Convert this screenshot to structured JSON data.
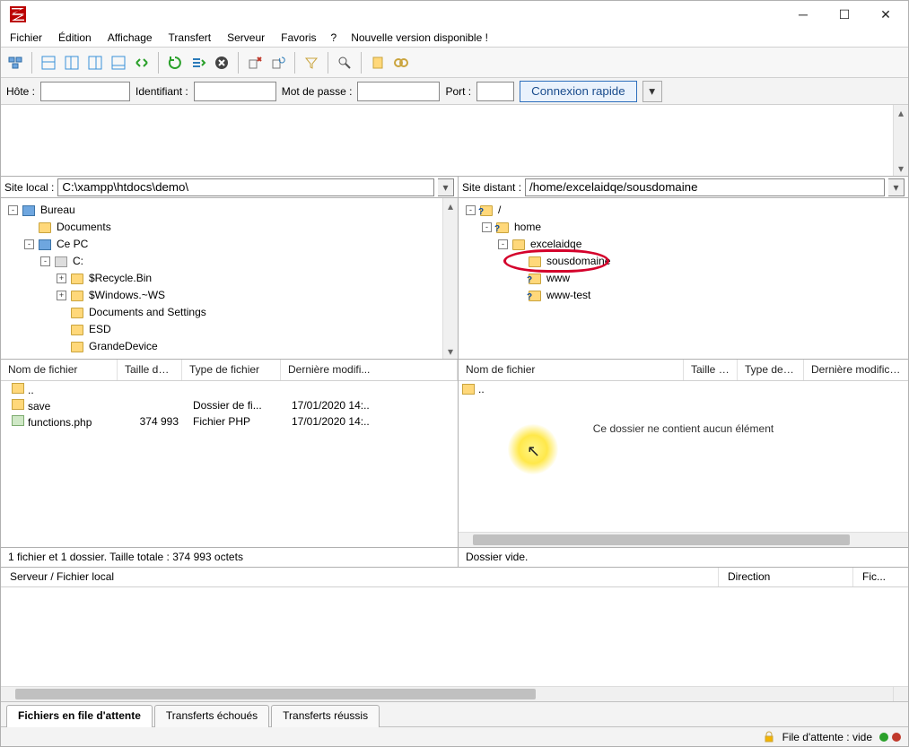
{
  "menubar": [
    "Fichier",
    "Édition",
    "Affichage",
    "Transfert",
    "Serveur",
    "Favoris",
    "?",
    "Nouvelle version disponible !"
  ],
  "quickconnect": {
    "host_label": "Hôte :",
    "user_label": "Identifiant :",
    "pass_label": "Mot de passe :",
    "port_label": "Port :",
    "button": "Connexion rapide"
  },
  "local": {
    "label": "Site local :",
    "path": "C:\\xampp\\htdocs\\demo\\",
    "tree": [
      {
        "indent": 0,
        "toggle": "-",
        "icon": "pc",
        "label": "Bureau"
      },
      {
        "indent": 1,
        "toggle": "",
        "icon": "fold",
        "label": "Documents"
      },
      {
        "indent": 1,
        "toggle": "-",
        "icon": "pc",
        "label": "Ce PC"
      },
      {
        "indent": 2,
        "toggle": "-",
        "icon": "drv",
        "label": "C:"
      },
      {
        "indent": 3,
        "toggle": "+",
        "icon": "fold",
        "label": "$Recycle.Bin"
      },
      {
        "indent": 3,
        "toggle": "+",
        "icon": "fold",
        "label": "$Windows.~WS"
      },
      {
        "indent": 3,
        "toggle": "",
        "icon": "fold",
        "label": "Documents and Settings"
      },
      {
        "indent": 3,
        "toggle": "",
        "icon": "fold",
        "label": "ESD"
      },
      {
        "indent": 3,
        "toggle": "",
        "icon": "fold",
        "label": "GrandeDevice"
      }
    ],
    "columns": [
      "Nom de fichier",
      "Taille de fi...",
      "Type de fichier",
      "Dernière modifi..."
    ],
    "files": [
      {
        "name": "..",
        "size": "",
        "type": "",
        "date": ""
      },
      {
        "name": "save",
        "size": "",
        "type": "Dossier de fi...",
        "date": "17/01/2020 14:..",
        "icon": "fold"
      },
      {
        "name": "functions.php",
        "size": "374 993",
        "type": "Fichier PHP",
        "date": "17/01/2020 14:..",
        "icon": "php"
      }
    ],
    "status": "1 fichier et 1 dossier. Taille totale : 374 993 octets"
  },
  "remote": {
    "label": "Site distant :",
    "path": "/home/excelaidqe/sousdomaine",
    "tree": [
      {
        "indent": 0,
        "toggle": "-",
        "icon": "q",
        "label": "/"
      },
      {
        "indent": 1,
        "toggle": "-",
        "icon": "q",
        "label": "home"
      },
      {
        "indent": 2,
        "toggle": "-",
        "icon": "fold",
        "label": "excelaidqe"
      },
      {
        "indent": 3,
        "toggle": "",
        "icon": "fold",
        "label": "sousdomaine",
        "circled": true
      },
      {
        "indent": 3,
        "toggle": "",
        "icon": "q",
        "label": "www"
      },
      {
        "indent": 3,
        "toggle": "",
        "icon": "q",
        "label": "www-test"
      }
    ],
    "columns": [
      "Nom de fichier",
      "Taille d...",
      "Type de fi...",
      "Dernière modifica..."
    ],
    "empty_row": "..",
    "empty_text": "Ce dossier ne contient aucun élément",
    "status": "Dossier vide."
  },
  "queue": {
    "columns": [
      "Serveur / Fichier local",
      "Direction",
      "Fic..."
    ]
  },
  "tabs": [
    "Fichiers en file d'attente",
    "Transferts échoués",
    "Transferts réussis"
  ],
  "bottom": {
    "queue_status": "File d'attente : vide"
  }
}
